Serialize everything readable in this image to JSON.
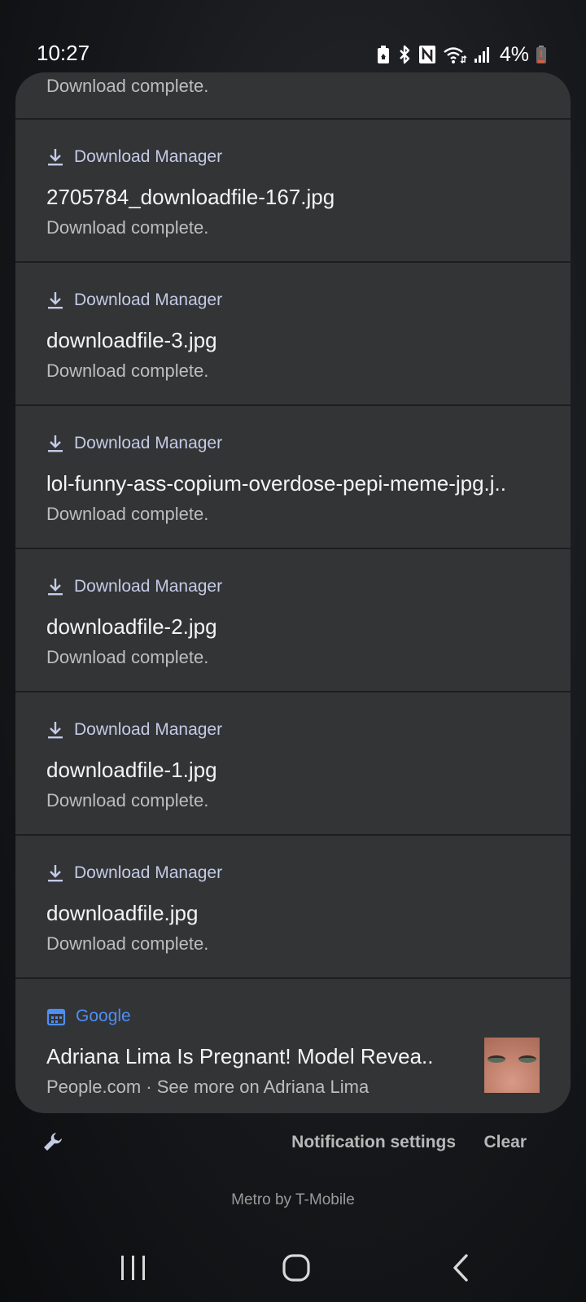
{
  "status_bar": {
    "time": "10:27",
    "battery_percent": "4%",
    "icons": [
      "battery-saver-icon",
      "bluetooth-icon",
      "nfc-icon",
      "wifi-icon",
      "signal-icon",
      "battery-icon"
    ]
  },
  "partial_notification": {
    "text": "Download complete."
  },
  "notifications": [
    {
      "app": "Download Manager",
      "title": "2705784_downloadfile-167.jpg",
      "text": "Download complete.",
      "icon": "download-icon"
    },
    {
      "app": "Download Manager",
      "title": "downloadfile-3.jpg",
      "text": "Download complete.",
      "icon": "download-icon"
    },
    {
      "app": "Download Manager",
      "title": "lol-funny-ass-copium-overdose-pepi-meme-jpg.j..",
      "text": "Download complete.",
      "icon": "download-icon"
    },
    {
      "app": "Download Manager",
      "title": "downloadfile-2.jpg",
      "text": "Download complete.",
      "icon": "download-icon"
    },
    {
      "app": "Download Manager",
      "title": "downloadfile-1.jpg",
      "text": "Download complete.",
      "icon": "download-icon"
    },
    {
      "app": "Download Manager",
      "title": "downloadfile.jpg",
      "text": "Download complete.",
      "icon": "download-icon"
    }
  ],
  "google_notification": {
    "app": "Google",
    "title": "Adriana Lima Is Pregnant! Model Revea..",
    "text": "People.com · See more on Adriana Lima",
    "icon": "calendar-icon",
    "accent_color": "#4d8ff5"
  },
  "actions": {
    "settings_label": "Notification settings",
    "clear_label": "Clear"
  },
  "carrier": "Metro by T-Mobile",
  "colors": {
    "panel": "#333436",
    "app_label": "#c4cbe6"
  }
}
